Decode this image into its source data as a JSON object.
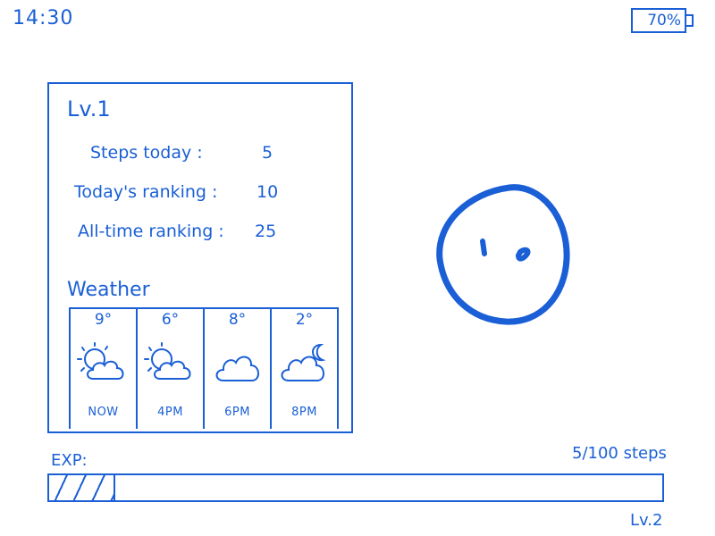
{
  "status_bar": {
    "time": "14:30",
    "battery": "70%"
  },
  "stats": {
    "level": "Lv.1",
    "rows": [
      {
        "label": "Steps today :",
        "value": "5"
      },
      {
        "label": "Today's ranking :",
        "value": "10"
      },
      {
        "label": "All-time ranking :",
        "value": "25"
      }
    ]
  },
  "weather": {
    "title": "Weather",
    "forecast": [
      {
        "temp": "9°",
        "time": "NOW",
        "icon": "sun-cloud-icon"
      },
      {
        "temp": "6°",
        "time": "4PM",
        "icon": "sun-cloud-icon"
      },
      {
        "temp": "8°",
        "time": "6PM",
        "icon": "cloud-icon"
      },
      {
        "temp": "2°",
        "time": "8PM",
        "icon": "moon-cloud-icon"
      }
    ]
  },
  "exp": {
    "label": "EXP:",
    "steps_text": "5/100 steps",
    "progress_fraction": 0.05,
    "next_level": "Lv.2"
  },
  "colors": {
    "ink": "#1a5fd6"
  }
}
